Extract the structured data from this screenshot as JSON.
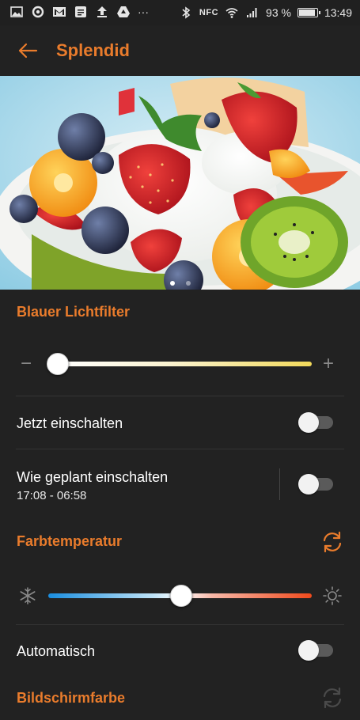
{
  "status_bar": {
    "left_icons": [
      "gallery-icon",
      "sync-icon",
      "gmail-icon",
      "notes-icon",
      "upload-icon",
      "drive-icon",
      "more-icon"
    ],
    "overflow": "···",
    "nfc": "NFC",
    "battery_percent": "93 %",
    "battery_level": 0.93,
    "time": "13:49"
  },
  "app_bar": {
    "title": "Splendid"
  },
  "hero": {
    "image": "fruit-salad-photo",
    "pages": 2,
    "active_page": 1
  },
  "blue_light": {
    "title": "Blauer Lichtfilter",
    "minus": "−",
    "plus": "+",
    "level": 0.0
  },
  "now_toggle": {
    "label": "Jetzt einschalten",
    "on": false
  },
  "scheduled": {
    "label": "Wie geplant einschalten",
    "time_range": "17:08 - 06:58",
    "on": false
  },
  "color_temp": {
    "title": "Farbtemperatur",
    "level": 0.5,
    "icons": [
      "reset-icon",
      "snowflake-icon",
      "sun-icon"
    ]
  },
  "automatic": {
    "label": "Automatisch",
    "on": false
  },
  "screen_color": {
    "title": "Bildschirmfarbe"
  },
  "colors": {
    "accent": "#ea7c2c",
    "background": "#222222"
  }
}
